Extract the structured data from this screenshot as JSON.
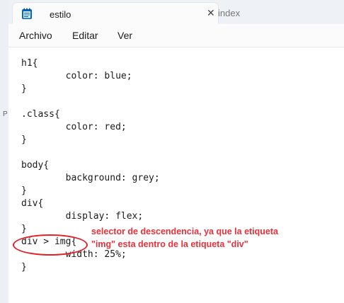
{
  "left_peek": "P",
  "tabs": [
    {
      "title": "estilo",
      "close": "✕",
      "active": true
    },
    {
      "title": "index",
      "active": false
    }
  ],
  "menu": [
    "Archivo",
    "Editar",
    "Ver"
  ],
  "code_lines": [
    "h1{",
    "\tcolor: blue;",
    "}",
    "",
    ".class{",
    "\tcolor: red;",
    "}",
    "",
    "body{",
    "\tbackground: grey;",
    "}",
    "div{",
    "\tdisplay: flex;",
    "}",
    "div > img{",
    "\twidth: 25%;",
    "}"
  ],
  "annotation": {
    "line1": "selector de descendencia, ya que la etiqueta",
    "line2": "\"img\" esta dentro de la etiqueta \"div\"",
    "color": "#e8303a"
  },
  "colors": {
    "titlebar": "#eef1f6",
    "accent_icon": "#0067c0",
    "highlight_ellipse": "#e3202a"
  },
  "icons": {
    "app": "notepad-icon",
    "close": "close-icon"
  }
}
